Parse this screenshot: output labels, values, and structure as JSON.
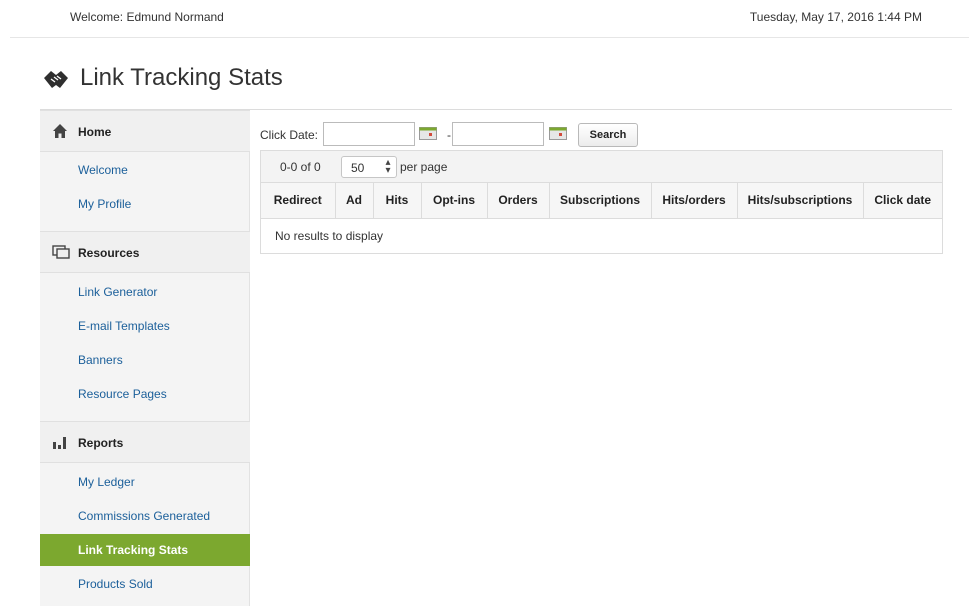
{
  "header": {
    "welcome": "Welcome: Edmund Normand",
    "datetime": "Tuesday, May 17, 2016 1:44 PM"
  },
  "page": {
    "title": "Link Tracking Stats",
    "title_icon": "handshake-icon"
  },
  "sidebar": {
    "sections": [
      {
        "label": "Home",
        "icon": "home-icon",
        "items": [
          "Welcome",
          "My Profile"
        ]
      },
      {
        "label": "Resources",
        "icon": "monitor-icon",
        "items": [
          "Link Generator",
          "E-mail Templates",
          "Banners",
          "Resource Pages"
        ]
      },
      {
        "label": "Reports",
        "icon": "bar-chart-icon",
        "items": [
          "My Ledger",
          "Commissions Generated",
          "Link Tracking Stats",
          "Products Sold"
        ]
      }
    ],
    "active_item": "Link Tracking Stats",
    "active_color": "#7ca82f"
  },
  "filter": {
    "label": "Click Date:",
    "from_value": "",
    "separator": "-",
    "to_value": "",
    "search_label": "Search"
  },
  "pager": {
    "count": "0-0 of 0",
    "per_page_value": "50",
    "per_page_label": "per page"
  },
  "table": {
    "columns": [
      "Redirect",
      "Ad",
      "Hits",
      "Opt-ins",
      "Orders",
      "Subscriptions",
      "Hits/orders",
      "Hits/subscriptions",
      "Click date"
    ],
    "empty_message": "No results to display"
  },
  "colors": {
    "link": "#1b5f9a",
    "accent": "#7ca82f"
  }
}
